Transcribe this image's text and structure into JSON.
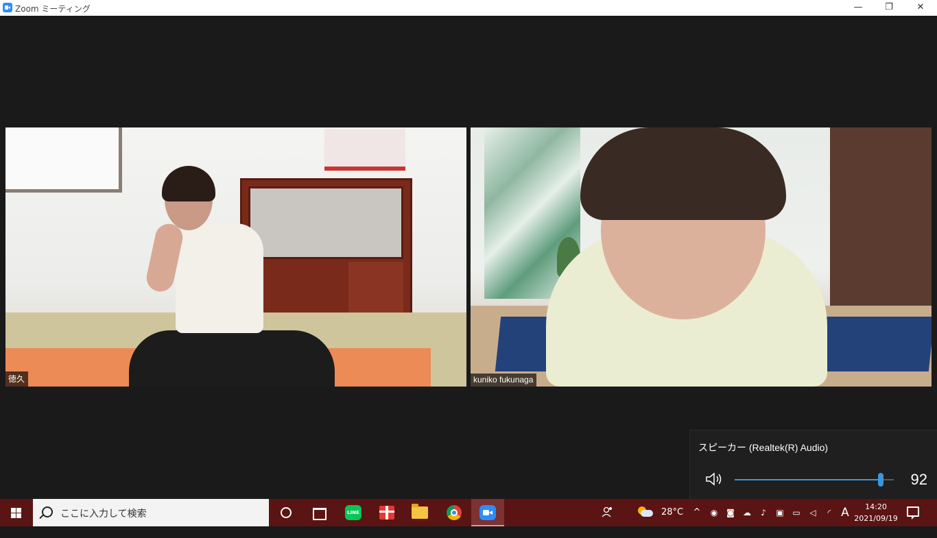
{
  "window": {
    "title": "Zoom ミーティング",
    "minimize_glyph": "—",
    "restore_glyph": "❐",
    "close_glyph": "✕"
  },
  "participants": [
    {
      "name": "徳久"
    },
    {
      "name": "kuniko fukunaga"
    }
  ],
  "volume_flyout": {
    "device": "スピーカー (Realtek(R) Audio)",
    "volume": "92",
    "level_percent": 92,
    "accent_color": "#3a96dd"
  },
  "taskbar": {
    "search_placeholder": "ここに入力して検索",
    "apps": [
      {
        "icon": "cortana-icon"
      },
      {
        "icon": "task-view-icon"
      },
      {
        "icon": "line-app-icon",
        "label": "LINE"
      },
      {
        "icon": "gift-app-icon"
      },
      {
        "icon": "file-explorer-icon"
      },
      {
        "icon": "chrome-icon"
      },
      {
        "icon": "zoom-app-icon"
      }
    ],
    "weather_temp": "28°C",
    "ime_label": "A",
    "time": "14:20",
    "date": "2021/09/19",
    "background_color": "#5b1414"
  }
}
